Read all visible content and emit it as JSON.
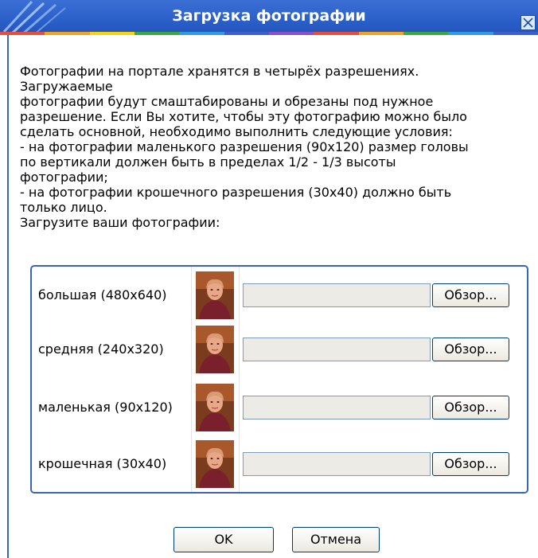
{
  "window": {
    "title": "Загрузка фотографии",
    "close_icon": "close-icon",
    "stripe_colors": [
      "#e84d3c",
      "#f7a21b",
      "#f5d60a",
      "#3aa843",
      "#2f9be0",
      "#3a5fcf",
      "#8a4fc9",
      "#e84d3c",
      "#f7a21b",
      "#3aa843",
      "#2f9be0",
      "#3a5fcf"
    ]
  },
  "intro": {
    "text": "Фотографии на портале хранятся в четырёх разрешениях.\nЗагружаемые\nфотографии будут смаштабированы и обрезаны под нужное\nразрешение. Если Вы хотите, чтобы эту фотографию можно было\nсделать основной, необходимо выполнить следующие условия:\n- на фотографии маленького разрешения (90х120) размер головы\nпо вертикали должен быть в пределах 1/2 - 1/3 высоты\nфотографии;\n- на фотографии крошечного разрешения (30х40) должно быть\nтолько лицо.\nЗагрузите ваши фотографии:"
  },
  "upload": {
    "rows": [
      {
        "label": "большая (480х640)",
        "file_value": "",
        "browse_label": "Обзор..."
      },
      {
        "label": "средняя (240х320)",
        "file_value": "",
        "browse_label": "Обзор..."
      },
      {
        "label": "маленькая (90х120)",
        "file_value": "",
        "browse_label": "Обзор..."
      },
      {
        "label": "крошечная (30х40)",
        "file_value": "",
        "browse_label": "Обзор..."
      }
    ]
  },
  "footer": {
    "ok_label": "OK",
    "cancel_label": "Отмена"
  }
}
